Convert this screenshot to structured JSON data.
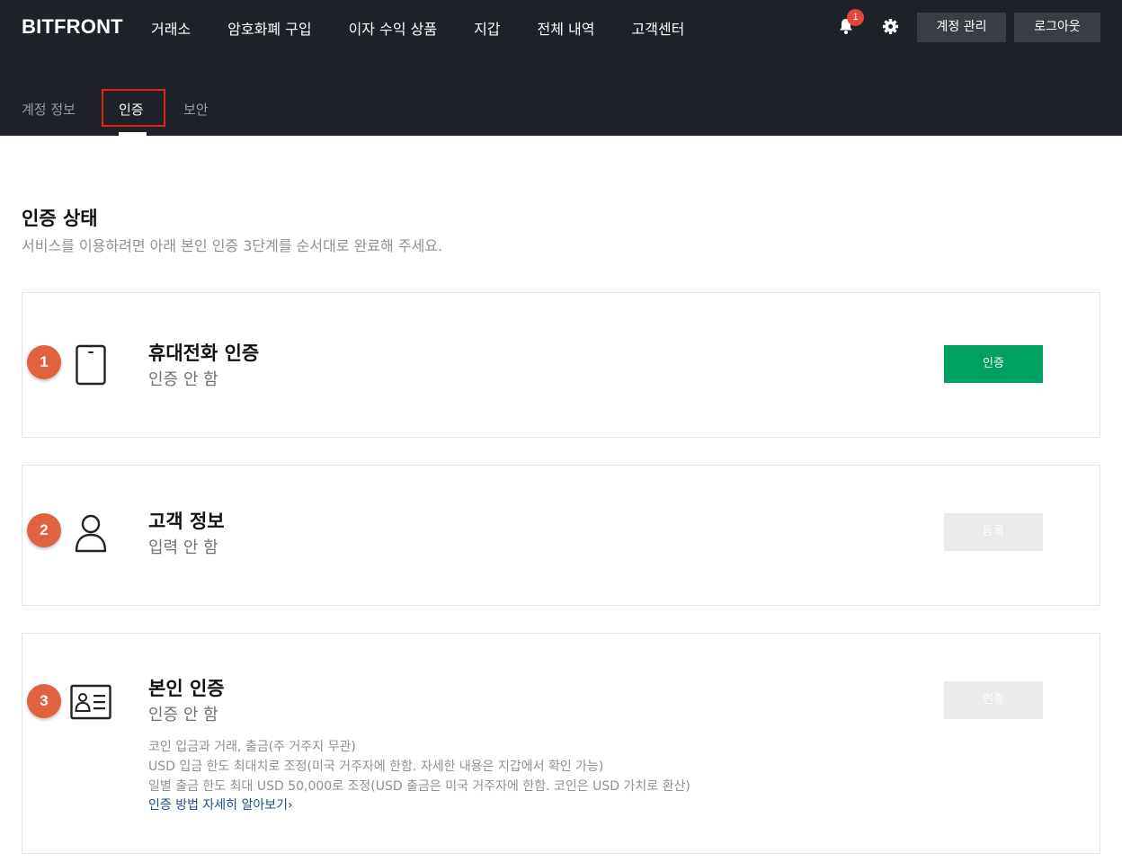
{
  "header": {
    "logo": "BITFRONT",
    "nav": [
      "거래소",
      "암호화폐 구입",
      "이자 수익 상품",
      "지갑",
      "전체 내역",
      "고객센터"
    ],
    "notification_count": "1",
    "account_button": "계정 관리",
    "logout_button": "로그아웃",
    "bg_color": "#1f2129"
  },
  "subtabs": {
    "items": [
      "계정 정보",
      "인증",
      "보안"
    ],
    "active": "인증"
  },
  "section": {
    "title": "인증 상태",
    "description": "서비스를 이용하려면 아래 본인 인증 3단계를 순서대로 완료해 주세요."
  },
  "steps": [
    {
      "number": "1",
      "icon": "phone-icon",
      "title": "휴대전화 인증",
      "status": "인증 안 함",
      "button": "인증",
      "button_state": "enabled",
      "button_color": "#00a062"
    },
    {
      "number": "2",
      "icon": "person-icon",
      "title": "고객 정보",
      "status": "입력 안 함",
      "button": "등록",
      "button_state": "disabled"
    },
    {
      "number": "3",
      "icon": "id-card-icon",
      "title": "본인 인증",
      "status": "인증 안 함",
      "button": "인증",
      "button_state": "disabled",
      "info": [
        "코인 입금과 거래, 출금(주 거주지 무관)",
        "USD 입금 한도 최대치로 조정(미국 거주자에 한함. 자세한 내용은 지갑에서 확인 가능)",
        "일별 출금 한도 최대 USD 50,000로 조정(USD 출금은 미국 거주자에 한함. 코인은 USD 가치로 환산)"
      ],
      "link": "인증 방법 자세히 알아보기"
    }
  ],
  "colors": {
    "step_badge": "#e0623f",
    "link": "#1f4d8c",
    "tab_highlight": "#e2231a"
  }
}
